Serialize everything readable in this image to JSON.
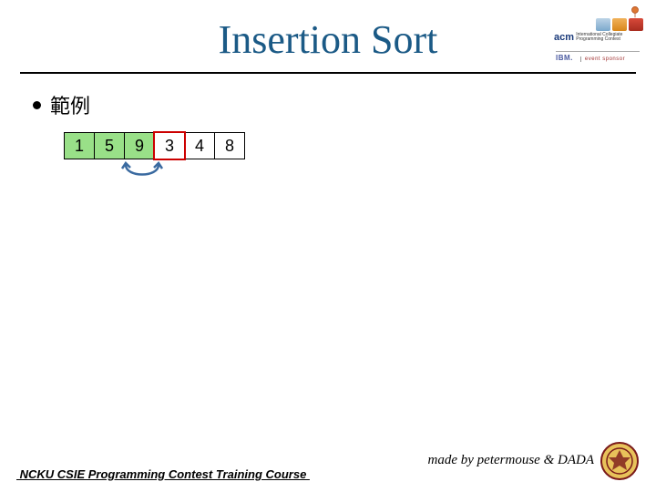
{
  "title": "Insertion Sort",
  "bullet": {
    "example_label": "範例"
  },
  "array": {
    "cells": [
      {
        "value": "1",
        "state": "sorted"
      },
      {
        "value": "5",
        "state": "sorted"
      },
      {
        "value": "9",
        "state": "sorted"
      },
      {
        "value": "3",
        "state": "current"
      },
      {
        "value": "4",
        "state": "unsorted"
      },
      {
        "value": "8",
        "state": "unsorted"
      }
    ],
    "swap_arrow_between_indices": [
      2,
      3
    ]
  },
  "logos": {
    "balloon_icon": "balloon-icon",
    "acm_text": "acm",
    "acm_sub1": "International Collegiate",
    "acm_sub2": "Programming Contest",
    "ibm_text": "IBM.",
    "ibm_event": "event sponsor"
  },
  "footer": {
    "left": " NCKU CSIE Programming Contest Training Course ",
    "credit": "made by petermouse & DADA"
  },
  "colors": {
    "title": "#1b5a86",
    "sorted_bg": "#99e088",
    "current_outline": "#c00000"
  }
}
